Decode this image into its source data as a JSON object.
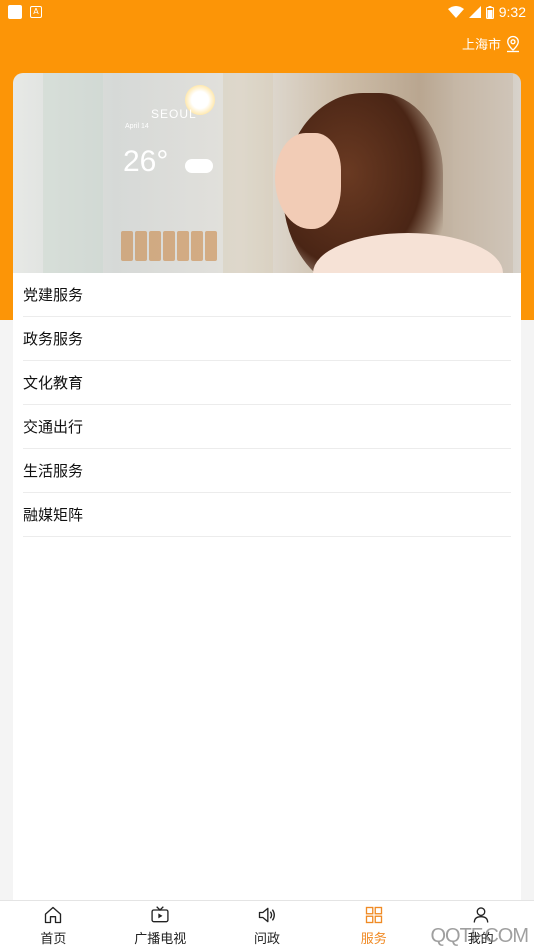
{
  "status_bar": {
    "time": "9:32"
  },
  "header": {
    "city": "上海市",
    "city_icon": "location-pin-icon"
  },
  "banner": {
    "weather_city": "SEOUL",
    "weather_date": "April 14",
    "weather_temp": "26°"
  },
  "menu": {
    "items": [
      {
        "label": "党建服务"
      },
      {
        "label": "政务服务"
      },
      {
        "label": "文化教育"
      },
      {
        "label": "交通出行"
      },
      {
        "label": "生活服务"
      },
      {
        "label": "融媒矩阵"
      }
    ]
  },
  "bottom_nav": {
    "active_color": "#f08a24",
    "items": [
      {
        "label": "首页",
        "icon": "home-icon"
      },
      {
        "label": "广播电视",
        "icon": "tv-icon"
      },
      {
        "label": "问政",
        "icon": "speaker-icon"
      },
      {
        "label": "服务",
        "icon": "grid-icon",
        "active": true
      },
      {
        "label": "我的",
        "icon": "user-icon"
      }
    ]
  },
  "watermark": "QQTF.COM",
  "colors": {
    "brand_orange": "#fc9507"
  }
}
